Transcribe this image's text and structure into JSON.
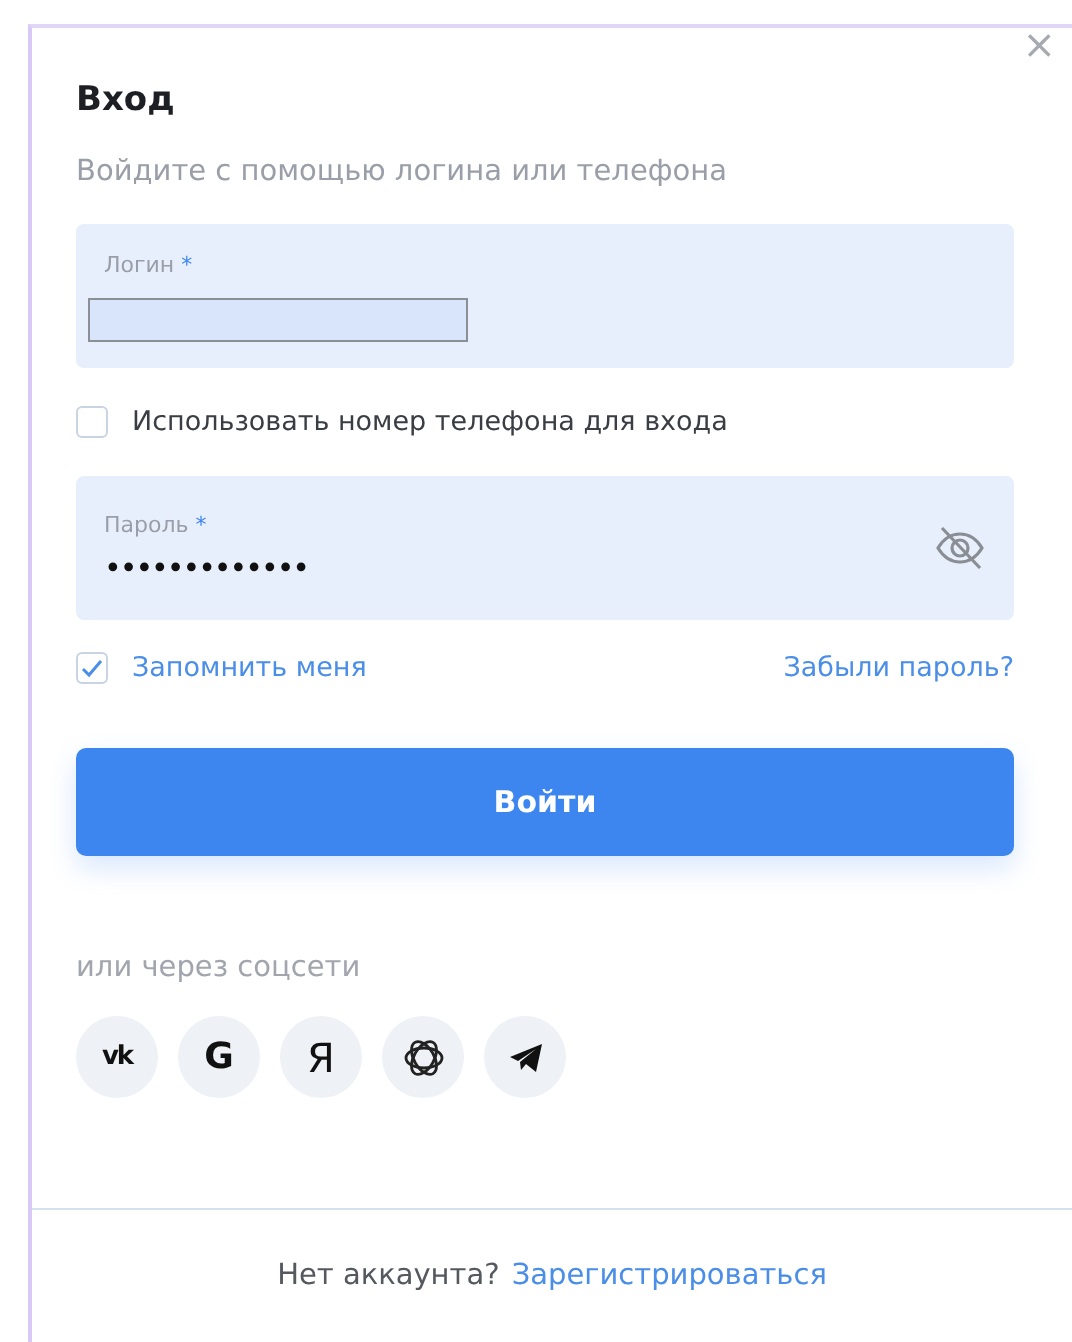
{
  "dialog": {
    "title": "Вход",
    "subtitle": "Войдите с помощью логина или телефона",
    "close": "×"
  },
  "login_field": {
    "label": "Логин",
    "required_mark": "*"
  },
  "phone_option": {
    "label": "Использовать номер телефона для входа",
    "checked": false
  },
  "password_field": {
    "label": "Пароль",
    "required_mark": "*",
    "value": "•••••••••••••"
  },
  "remember": {
    "label": "Запомнить меня",
    "checked": true
  },
  "forgot_link": "Забыли пароль?",
  "submit_button": "Войти",
  "social": {
    "caption": "или через соцсети",
    "buttons": [
      {
        "kind": "vk",
        "glyph": "vk"
      },
      {
        "kind": "google",
        "glyph": "G"
      },
      {
        "kind": "yandex",
        "glyph": "Я"
      },
      {
        "kind": "ring"
      },
      {
        "kind": "telegram"
      }
    ]
  },
  "footer": {
    "text": "Нет аккаунта?",
    "link": "Зарегистрироваться"
  }
}
